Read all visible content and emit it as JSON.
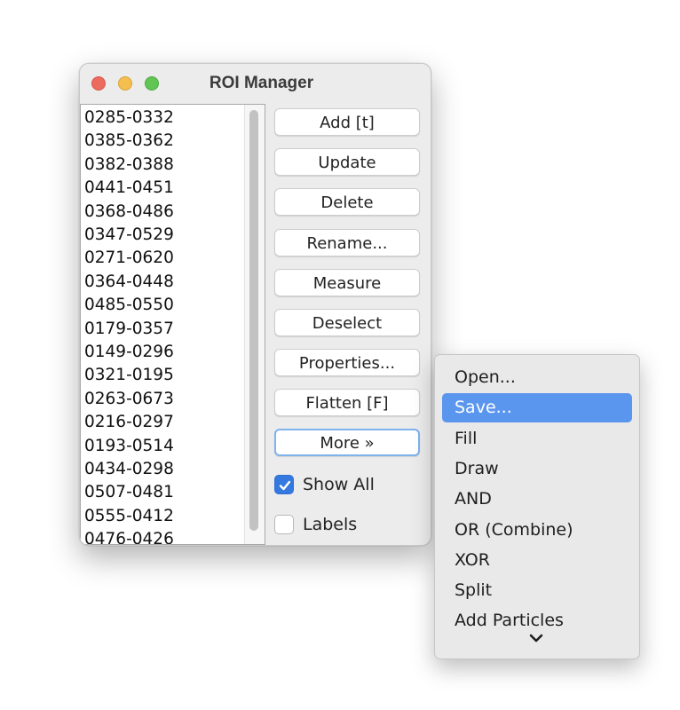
{
  "window": {
    "title": "ROI Manager"
  },
  "roi_list": {
    "items": [
      "0285-0332",
      "0385-0362",
      "0382-0388",
      "0441-0451",
      "0368-0486",
      "0347-0529",
      "0271-0620",
      "0364-0448",
      "0485-0550",
      "0179-0357",
      "0149-0296",
      "0321-0195",
      "0263-0673",
      "0216-0297",
      "0193-0514",
      "0434-0298",
      "0507-0481",
      "0555-0412",
      "0476-0426"
    ]
  },
  "buttons": {
    "add": "Add [t]",
    "update": "Update",
    "delete": "Delete",
    "rename": "Rename...",
    "measure": "Measure",
    "deselect": "Deselect",
    "properties": "Properties...",
    "flatten": "Flatten [F]",
    "more": "More »"
  },
  "checkboxes": {
    "show_all": {
      "label": "Show All",
      "checked": true
    },
    "labels": {
      "label": "Labels",
      "checked": false
    }
  },
  "more_menu": {
    "items": [
      "Open...",
      "Save...",
      "Fill",
      "Draw",
      "AND",
      "OR (Combine)",
      "XOR",
      "Split",
      "Add Particles"
    ],
    "selected": "Save...",
    "overflow_icon": "chevron-down-icon"
  },
  "colors": {
    "traffic_close": "#ed6a5e",
    "traffic_minimize": "#f5bf4f",
    "traffic_maximize": "#61c554",
    "selection": "#5b96ee",
    "checkbox_on": "#3579e0"
  }
}
